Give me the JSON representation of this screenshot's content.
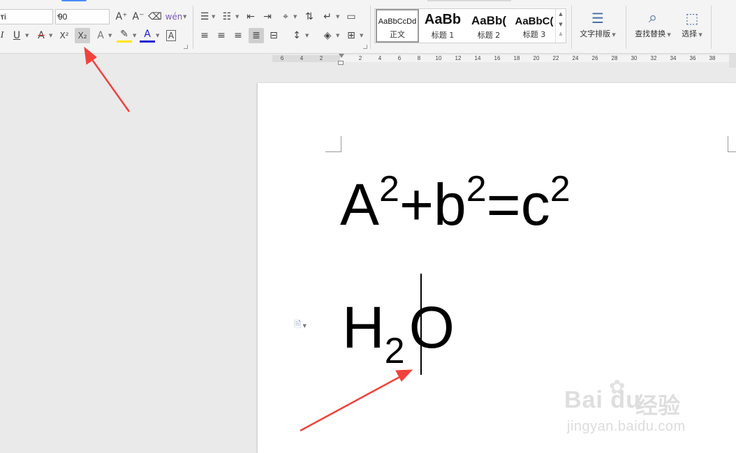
{
  "ribbon": {
    "font_name": "ri",
    "font_size": "90",
    "font_buttons": {
      "grow": "A⁺",
      "shrink": "A⁻",
      "clear": "⌫",
      "phonetic": "wén",
      "italic": "I",
      "underline": "U",
      "strike": "A",
      "superscript": "X²",
      "subscript": "X₂",
      "effects": "A",
      "highlight": "✎",
      "font_color": "A",
      "char_border": "A"
    },
    "styles": [
      {
        "sample": "AaBbCcDd",
        "name": "正文"
      },
      {
        "sample": "AaBb",
        "name": "标题 1"
      },
      {
        "sample": "AaBb(",
        "name": "标题 2"
      },
      {
        "sample": "AaBbC(",
        "name": "标题 3"
      }
    ],
    "text_layout_label": "文字排版",
    "find_replace_label": "查找替换",
    "select_label": "选择"
  },
  "ruler": {
    "ticks": [
      "6",
      "4",
      "2",
      "",
      "2",
      "4",
      "6",
      "8",
      "10",
      "12",
      "14",
      "16",
      "18",
      "20",
      "22",
      "24",
      "26",
      "28",
      "30",
      "32",
      "34",
      "36",
      "38"
    ]
  },
  "document": {
    "line1": {
      "a": "A",
      "a_exp": "2",
      "plus": "+b",
      "b_exp": "2",
      "eq": "=c",
      "c_exp": "2"
    },
    "line2": {
      "h": "H",
      "sub": "2",
      "o": "O"
    }
  },
  "watermark": {
    "logo": "Bai du",
    "cn": "经验",
    "url": "jingyan.baidu.com"
  },
  "colors": {
    "arrow": "#f2423b",
    "highlight": "#ffe600",
    "font_color": "#1c1cd0",
    "accent": "#4b8df8"
  }
}
